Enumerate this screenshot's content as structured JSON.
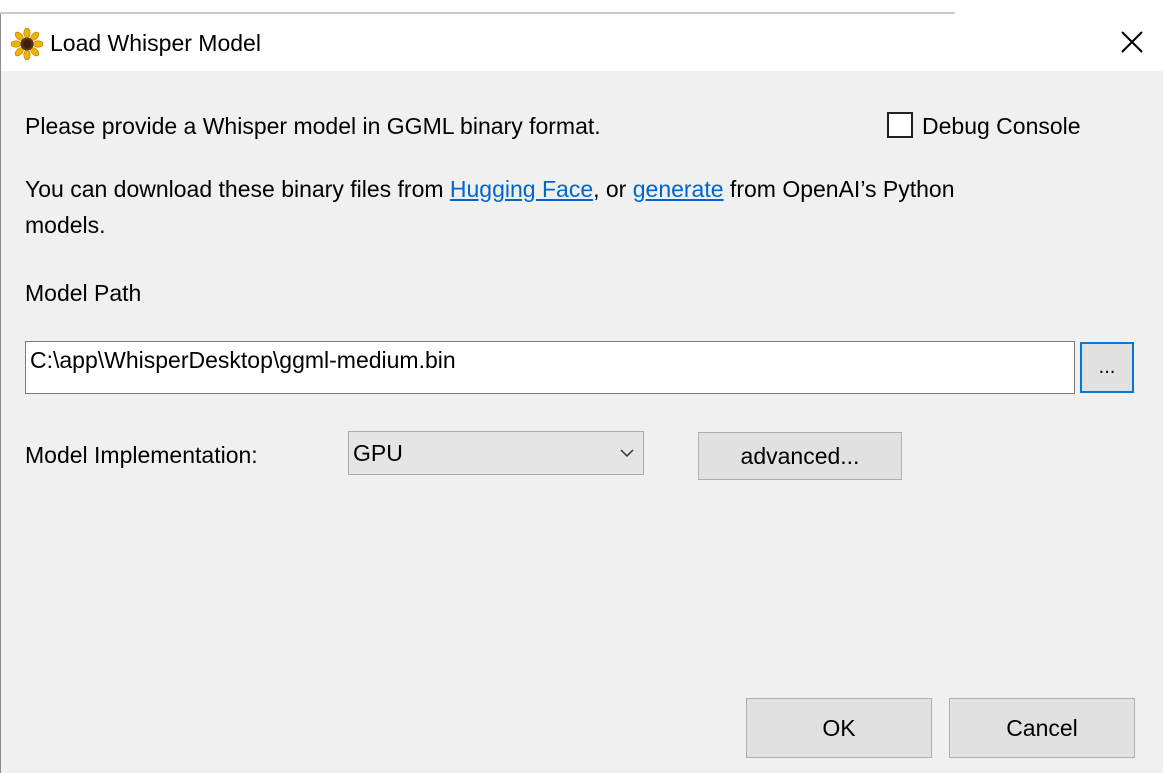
{
  "dialog": {
    "title": "Load Whisper Model",
    "intro": "Please provide a Whisper model in GGML binary format.",
    "debug_console_label": "Debug Console",
    "debug_console_checked": false,
    "download_text_1": "You can download these binary files from ",
    "hugging_face_link": "Hugging Face",
    "download_text_2": ", or ",
    "generate_link": "generate",
    "download_text_3": " from OpenAI’s Python",
    "download_text_4": "models.",
    "model_path_label": "Model Path",
    "model_path_value": "C:\\app\\WhisperDesktop\\ggml-medium.bin",
    "browse_label": "...",
    "impl_label": "Model Implementation:",
    "impl_value": "GPU",
    "advanced_label": "advanced...",
    "ok_label": "OK",
    "cancel_label": "Cancel"
  },
  "icons": {
    "app": "sunflower-icon",
    "close": "close-icon",
    "dropdown": "chevron-down-icon"
  },
  "colors": {
    "link": "#0066cc",
    "focus_border": "#0078d7",
    "button_face": "#e1e1e1",
    "window_bg": "#f0f0f0"
  }
}
